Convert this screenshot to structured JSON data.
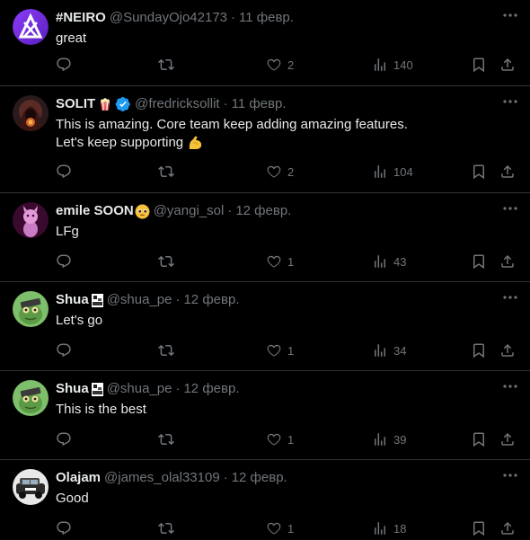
{
  "tweets": [
    {
      "name": "#NEIRO",
      "handle": "@SundayOjo42173",
      "date": "11 февр.",
      "lines": [
        "great"
      ],
      "likes": "2",
      "views": "140",
      "avatar": "neiro-icon",
      "badge": ""
    },
    {
      "name": "SOLIT",
      "handle": "@fredricksollit",
      "date": "11 февр.",
      "lines": [
        "This is amazing. Core team keep adding amazing features.",
        "Let's keep supporting"
      ],
      "likes": "2",
      "views": "104",
      "avatar": "hooded-figure-avatar",
      "badge": "popcorn-emoji,verified-badge"
    },
    {
      "name": "emile SOON",
      "handle": "@yangi_sol",
      "date": "12 февр.",
      "lines": [
        "LFg"
      ],
      "likes": "1",
      "views": "43",
      "avatar": "pink-creature-avatar",
      "badge": "pleading-face-emoji"
    },
    {
      "name": "Shua",
      "handle": "@shua_pe",
      "date": "12 февр.",
      "lines": [
        "Let's go"
      ],
      "likes": "1",
      "views": "34",
      "avatar": "green-frog-avatar",
      "badge": "pixel-badge"
    },
    {
      "name": "Shua",
      "handle": "@shua_pe",
      "date": "12 февр.",
      "lines": [
        "This is the best"
      ],
      "likes": "1",
      "views": "39",
      "avatar": "green-frog-avatar",
      "badge": "pixel-badge"
    },
    {
      "name": "Olajam",
      "handle": "@james_olal33109",
      "date": "12 февр.",
      "lines": [
        "Good"
      ],
      "likes": "1",
      "views": "18",
      "avatar": "car-avatar",
      "badge": ""
    }
  ],
  "colors": {
    "background": "#000000",
    "text": "#e7e9ea",
    "muted": "#71767b",
    "divider": "#2f3336",
    "verified": "#1d9bf0"
  }
}
